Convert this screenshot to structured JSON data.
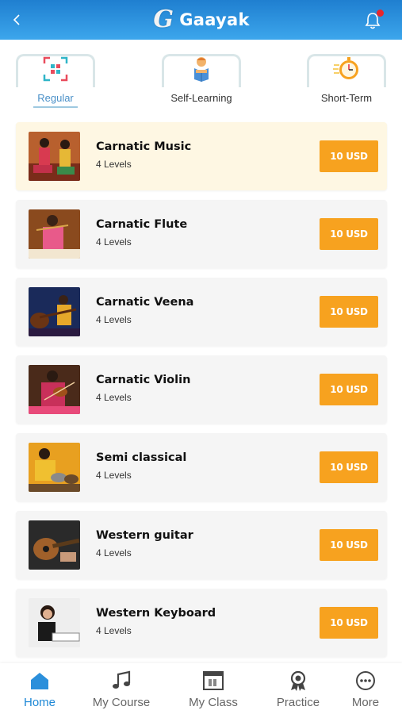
{
  "app": {
    "name": "Gaayak",
    "logo_letter": "G"
  },
  "colors": {
    "header": "#2b8fdb",
    "accent": "#f7a21f",
    "active_nav": "#1e88d6",
    "highlight_card": "#fef7e3"
  },
  "icons": {
    "back": "chevron-left-icon",
    "notifications": "bell-icon"
  },
  "categories": [
    {
      "label": "Regular",
      "icon": "scan-frame-icon",
      "active": true
    },
    {
      "label": "Self-Learning",
      "icon": "reader-icon",
      "active": false
    },
    {
      "label": "Short-Term",
      "icon": "stopwatch-icon",
      "active": false
    }
  ],
  "courses": [
    {
      "title": "Carnatic Music",
      "levels": "4 Levels",
      "price": "10 USD",
      "image": "singers-photo"
    },
    {
      "title": "Carnatic Flute",
      "levels": "4 Levels",
      "price": "10 USD",
      "image": "flute-player-photo"
    },
    {
      "title": "Carnatic Veena",
      "levels": "4 Levels",
      "price": "10 USD",
      "image": "veena-player-photo"
    },
    {
      "title": "Carnatic Violin",
      "levels": "4 Levels",
      "price": "10 USD",
      "image": "violin-player-photo"
    },
    {
      "title": "Semi classical",
      "levels": "4 Levels",
      "price": "10 USD",
      "image": "tabla-player-photo"
    },
    {
      "title": "Western guitar",
      "levels": "4 Levels",
      "price": "10 USD",
      "image": "guitar-photo"
    },
    {
      "title": "Western Keyboard",
      "levels": "4 Levels",
      "price": "10 USD",
      "image": "keyboard-player-photo"
    }
  ],
  "bottom_nav": [
    {
      "label": "Home",
      "icon": "home-icon",
      "active": true
    },
    {
      "label": "My Course",
      "icon": "music-note-icon",
      "active": false
    },
    {
      "label": "My Class",
      "icon": "class-board-icon",
      "active": false
    },
    {
      "label": "Practice",
      "icon": "practice-badge-icon",
      "active": false
    },
    {
      "label": "More",
      "icon": "more-dots-icon",
      "active": false
    }
  ]
}
